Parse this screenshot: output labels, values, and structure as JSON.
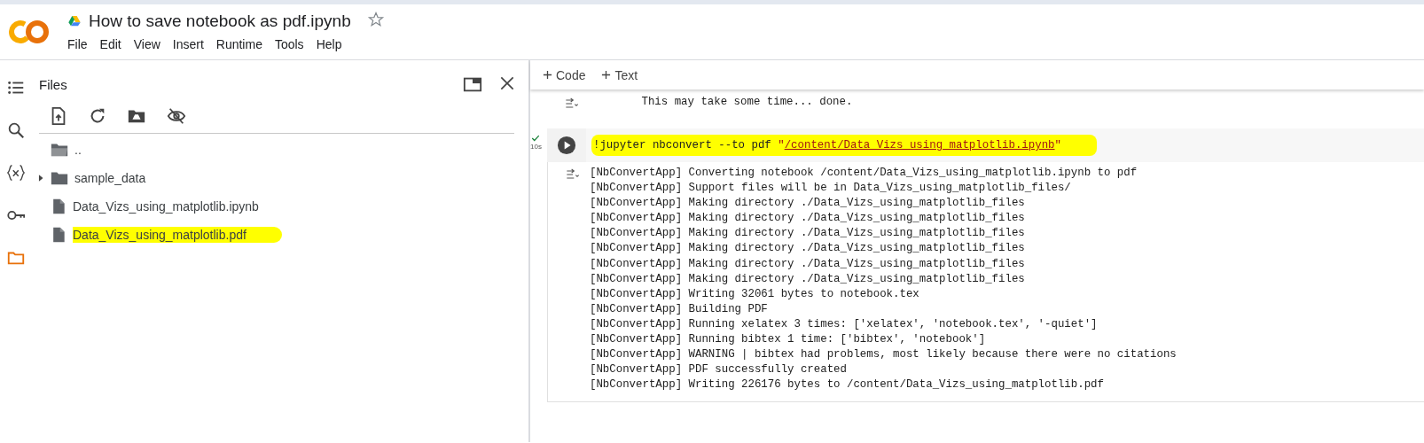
{
  "header": {
    "title": "How to save notebook as pdf.ipynb",
    "starred": false,
    "menu": [
      "File",
      "Edit",
      "View",
      "Insert",
      "Runtime",
      "Tools",
      "Help"
    ]
  },
  "rail": [
    {
      "kind": "list",
      "selected": false
    },
    {
      "kind": "search",
      "selected": false
    },
    {
      "kind": "variables",
      "selected": false
    },
    {
      "kind": "key",
      "selected": false
    },
    {
      "kind": "folder",
      "selected": true
    }
  ],
  "files_panel": {
    "title": "Files",
    "items": [
      {
        "name": "..",
        "kind": "parent",
        "highlighted": false
      },
      {
        "name": "sample_data",
        "kind": "folder",
        "expanded": false,
        "highlighted": false
      },
      {
        "name": "Data_Vizs_using_matplotlib.ipynb",
        "kind": "file",
        "highlighted": false
      },
      {
        "name": "Data_Vizs_using_matplotlib.pdf",
        "kind": "file",
        "highlighted": true
      }
    ]
  },
  "toolbar": [
    "Code",
    "Text"
  ],
  "cells": [
    {
      "kind": "output",
      "lines": [
        "        This may take some time... done."
      ]
    },
    {
      "kind": "code",
      "done": true,
      "time": "10s",
      "code": "!jupyter nbconvert --to pdf \"",
      "link": "/content/Data_Vizs_using_matplotlib.ipynb",
      "code_end": "\"",
      "highlighted": true
    },
    {
      "kind": "output",
      "lines": [
        "[NbConvertApp] Converting notebook /content/Data_Vizs_using_matplotlib.ipynb to pdf",
        "[NbConvertApp] Support files will be in Data_Vizs_using_matplotlib_files/",
        "[NbConvertApp] Making directory ./Data_Vizs_using_matplotlib_files",
        "[NbConvertApp] Making directory ./Data_Vizs_using_matplotlib_files",
        "[NbConvertApp] Making directory ./Data_Vizs_using_matplotlib_files",
        "[NbConvertApp] Making directory ./Data_Vizs_using_matplotlib_files",
        "[NbConvertApp] Making directory ./Data_Vizs_using_matplotlib_files",
        "[NbConvertApp] Making directory ./Data_Vizs_using_matplotlib_files",
        "[NbConvertApp] Writing 32061 bytes to notebook.tex",
        "[NbConvertApp] Building PDF",
        "[NbConvertApp] Running xelatex 3 times: ['xelatex', 'notebook.tex', '-quiet']",
        "[NbConvertApp] Running bibtex 1 time: ['bibtex', 'notebook']",
        "[NbConvertApp] WARNING | bibtex had problems, most likely because there were no citations",
        "[NbConvertApp] PDF successfully created",
        "[NbConvertApp] Writing 226176 bytes to /content/Data_Vizs_using_matplotlib.pdf"
      ]
    }
  ]
}
